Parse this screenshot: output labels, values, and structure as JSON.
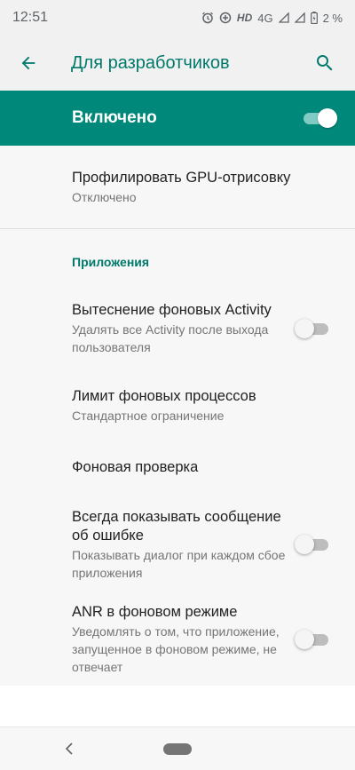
{
  "status_bar": {
    "time": "12:51",
    "network_label": "HD",
    "network_type": "4G",
    "battery": "2 %",
    "icons": [
      "alarm-icon",
      "data-saver-icon",
      "signal-icon",
      "signal-empty-icon",
      "battery-charging-icon"
    ]
  },
  "app_bar": {
    "title": "Для разработчиков",
    "icons": [
      "back-arrow-icon",
      "search-icon"
    ]
  },
  "master_switch": {
    "label": "Включено",
    "checked": true
  },
  "gpu_profile": {
    "title": "Профилировать GPU-отрисовку",
    "summary": "Отключено"
  },
  "category_apps": "Приложения",
  "items": [
    {
      "title": "Вытеснение фоновых Activity",
      "summary": "Удалять все Activity после выхода пользователя",
      "switch": false
    },
    {
      "title": "Лимит фоновых процессов",
      "summary": "Стандартное ограничение"
    },
    {
      "title": "Фоновая проверка"
    },
    {
      "title": "Всегда показывать сообщение об ошибке",
      "summary": "Показывать диалог при каждом сбое приложения",
      "switch": false
    },
    {
      "title": "ANR в фоновом режиме",
      "summary": "Уведомлять о том, что приложение, запущенное в фоновом режиме, не отвечает",
      "switch": false
    }
  ],
  "colors": {
    "accent": "#00897b",
    "accent_text": "#00796b",
    "background": "#f7f7f7",
    "toolbar": "#f1f1f1"
  }
}
